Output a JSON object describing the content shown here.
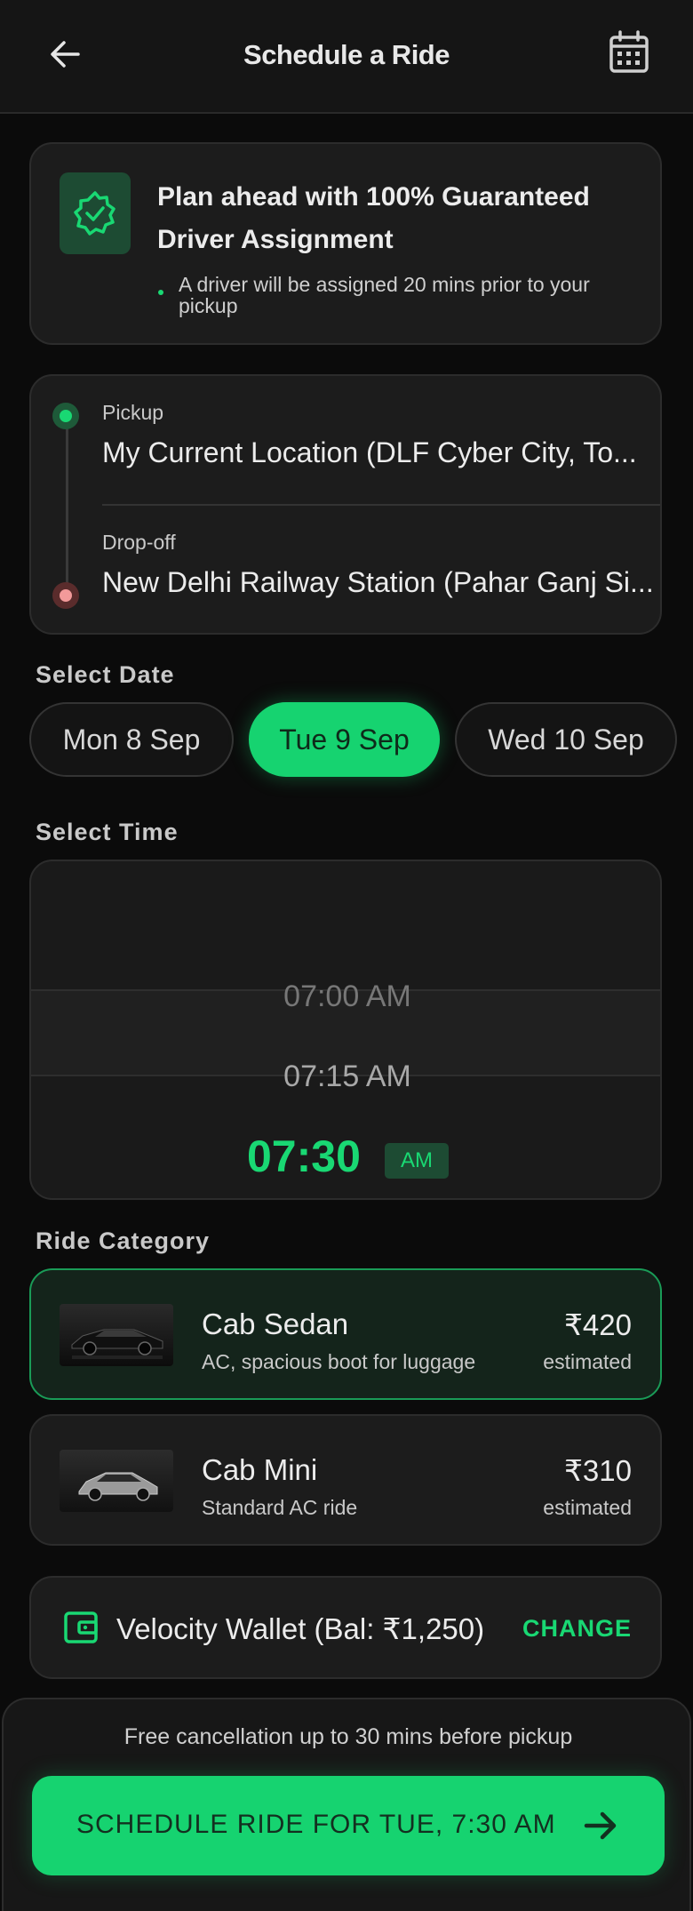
{
  "header": {
    "title": "Schedule a Ride",
    "back_icon": "arrow-left-icon",
    "calendar_icon": "calendar-icon"
  },
  "promo": {
    "icon": "verified-badge-icon",
    "title": "Plan ahead with 100% Guaranteed Driver Assignment",
    "subtitle": "A driver will be assigned 20 mins prior to your pickup"
  },
  "route": {
    "pickup_label": "Pickup",
    "pickup_value": "My Current Location (DLF Cyber City, To...",
    "dropoff_label": "Drop-off",
    "dropoff_value": "New Delhi Railway Station (Pahar Ganj Si..."
  },
  "date": {
    "label": "Select Date",
    "options": [
      "Mon 8 Sep",
      "Tue 9 Sep",
      "Wed 10 Sep"
    ],
    "selected": "Tue 9 Sep"
  },
  "time": {
    "label": "Select Time",
    "options": [
      "07:00 AM",
      "07:15 AM"
    ],
    "selected_time": "07:30",
    "selected_period": "AM"
  },
  "rides": {
    "label": "Ride Category",
    "items": [
      {
        "name": "Cab Sedan",
        "desc": "AC, spacious boot for luggage",
        "price": "₹420",
        "note": "estimated",
        "selected": true
      },
      {
        "name": "Cab Mini",
        "desc": "Standard AC ride",
        "price": "₹310",
        "note": "estimated",
        "selected": false
      }
    ]
  },
  "wallet": {
    "icon": "wallet-icon",
    "text": "Velocity Wallet (Bal: ₹1,250)",
    "action": "CHANGE"
  },
  "footer": {
    "note": "Free cancellation up to 30 mins before pickup",
    "cta": "SCHEDULE RIDE FOR TUE, 7:30 AM",
    "cta_icon": "arrow-right-icon"
  },
  "colors": {
    "accent": "#16d370",
    "background": "#0b0b0b",
    "card": "#1c1c1c",
    "dropoff_marker": "#f29a9a"
  }
}
